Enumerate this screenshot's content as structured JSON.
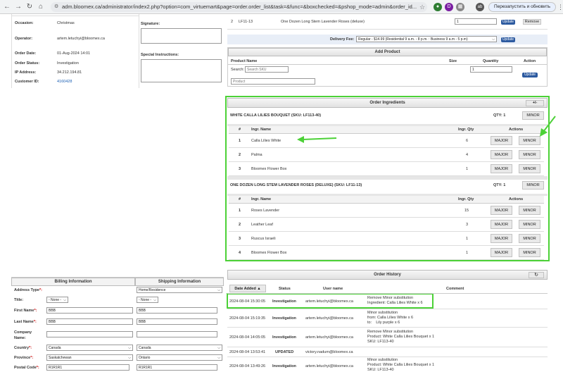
{
  "browser": {
    "url": "adm.bloomex.ca/administrator/index2.php?option=com_virtuemart&page=order.order_list&task=&func=&boxchecked=&pshop_mode=admin&order_id...",
    "restart_label": "Перезапустить и обновить",
    "ext_d": "D",
    "profile": "ab"
  },
  "order_info": {
    "occasion_label": "Occasion:",
    "occasion_value": "Christmas",
    "operator_label": "Operator:",
    "operator_value": "artem.letuchyi@bloomex.ca",
    "date_label": "Order Date:",
    "date_value": "01-Aug-2024 14:01",
    "status_label": "Order Status:",
    "status_value": "Investigation",
    "ip_label": "IP Address:",
    "ip_value": "34.212.194.81",
    "customer_label": "Customer ID:",
    "customer_value": "4160428",
    "signature_label": "Signature:",
    "instructions_label": "Special Instructions:"
  },
  "top_products": {
    "row_num": "2",
    "sku": "LF11-13",
    "name": "One Dozen Long Stem Lavender Roses (deluxe)",
    "qty": "1",
    "update_label": "Update",
    "remove_label": "Remove"
  },
  "delivery": {
    "label": "Delivery Fee:",
    "value": "Regular - $14.99 (Residential 9 a.m. - 8 p.m. : Business 9 a.m - 5 p.m)",
    "update_label": "Update"
  },
  "add_product": {
    "title": "Add Product",
    "col_name": "Product Name",
    "col_size": "Size",
    "col_qty": "Quantity",
    "col_action": "Action",
    "search_label": "Search:",
    "search_placeholder": "Search SKU",
    "product_placeholder": "Product",
    "qty_value": "1",
    "update_label": "Update"
  },
  "ingredients": {
    "title": "Order Ingredients",
    "toggle_label": "+/-",
    "col_num": "#",
    "col_name": "Ingr. Name",
    "col_qty": "Ingr. Qty",
    "col_actions": "Actions",
    "major_label": "MAJOR",
    "minor_label": "MINOR",
    "products": [
      {
        "title": "WHITE CALLA LILIES BOUQUET (SKU: LF113-40)",
        "qty": "QTY: 1",
        "items": [
          {
            "num": "1",
            "name": "Calla Lilies White",
            "qty": "6"
          },
          {
            "num": "2",
            "name": "Palma",
            "qty": "4"
          },
          {
            "num": "3",
            "name": "Bloomex Flower Box",
            "qty": "1"
          }
        ]
      },
      {
        "title": "ONE DOZEN LONG STEM LAVENDER ROSES (DELUXE) (SKU: LF11-13)",
        "qty": "QTY: 1",
        "items": [
          {
            "num": "1",
            "name": "Roses Lavender",
            "qty": "15"
          },
          {
            "num": "2",
            "name": "Leather Leaf",
            "qty": "3"
          },
          {
            "num": "3",
            "name": "Ruscus Israeli",
            "qty": "1"
          },
          {
            "num": "4",
            "name": "Bloomex Flower Box",
            "qty": "1"
          }
        ]
      }
    ]
  },
  "billing": {
    "billing_title": "Billing Information",
    "shipping_title": "Shipping Information",
    "rows": [
      {
        "label": "Address Type",
        "req": "*:",
        "bill": "",
        "ship": "Home/Residence"
      },
      {
        "label": "Title:",
        "req": "",
        "bill": "- None -",
        "ship": "- None -"
      },
      {
        "label": "First Name",
        "req": "*:",
        "bill": "BBB",
        "ship": "BBB"
      },
      {
        "label": "Last Name",
        "req": "*:",
        "bill": "BBB",
        "ship": "BBB"
      },
      {
        "label": "Company Name:",
        "req": "",
        "bill": "",
        "ship": ""
      },
      {
        "label": "Country",
        "req": "*:",
        "bill": "Canada",
        "ship": "Canada"
      },
      {
        "label": "Province",
        "req": "*:",
        "bill": "Saskatchewan",
        "ship": "Ontario"
      },
      {
        "label": "Postal Code",
        "req": "*:",
        "bill": "R1R1R1",
        "ship": "R1R1R1"
      }
    ]
  },
  "history": {
    "title": "Order History",
    "refresh_icon": "↻",
    "col_date": "Date Added ▲",
    "col_status": "Status",
    "col_user": "User name",
    "col_comment": "Comment",
    "rows": [
      {
        "date": "2024-08-04 15:30:05",
        "status": "Investigation",
        "user": "artem.letuchyi@bloomex.ca",
        "comment1": "Remove Minor substitution",
        "comment2": "Ingredient: Calla Lilies White x 6",
        "comment3": ""
      },
      {
        "date": "2024-08-04 15:19:35",
        "status": "Investigation",
        "user": "artem.letuchyi@bloomex.ca",
        "comment1": "Minor substitution",
        "comment2": "from: Calla Lilies White x 6",
        "comment3": "to:    Lily purple x 6"
      },
      {
        "date": "2024-08-04 14:05:05",
        "status": "Investigation",
        "user": "artem.letuchyi@bloomex.ca",
        "comment1": "Remove Minor substitution",
        "comment2": "Product: White Calla Lilies Bouquet x 1",
        "comment3": "SKU: LF113-40"
      },
      {
        "date": "2024-08-04 13:53:41",
        "status": "UPDATED",
        "user": "victory.nadum@bloomex.ca",
        "comment1": "",
        "comment2": "",
        "comment3": ""
      },
      {
        "date": "2024-08-04 13:49:26",
        "status": "Investigation",
        "user": "artem.letuchyi@bloomex.ca",
        "comment1": "Minor substitution",
        "comment2": "Product: White Calla Lilies Bouquet x 1",
        "comment3": "SKU: LF113-40"
      }
    ]
  }
}
